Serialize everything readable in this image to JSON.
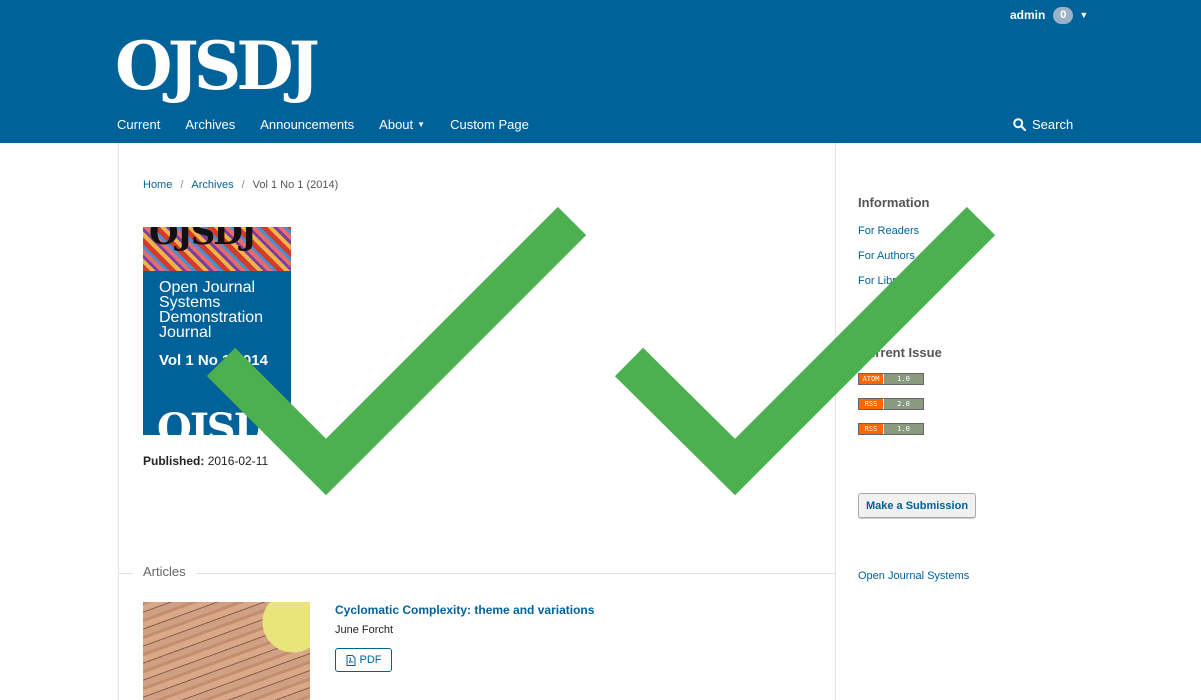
{
  "header": {
    "logo_text": "OJSDJ",
    "user": {
      "name": "admin",
      "task_count": "0"
    },
    "nav": [
      {
        "label": "Current"
      },
      {
        "label": "Archives"
      },
      {
        "label": "Announcements"
      },
      {
        "label": "About"
      },
      {
        "label": "Custom Page"
      }
    ],
    "search_label": "Search"
  },
  "breadcrumb": {
    "home": "Home",
    "archives": "Archives",
    "current": "Vol 1 No 1 (2014)",
    "separator": "/"
  },
  "issue": {
    "cover": {
      "top_logo": "OJSDJ",
      "title": "Open Journal Systems Demonstration Journal",
      "volume": "Vol 1 No 1 2014",
      "bottom_logo": "OJSDJ"
    },
    "published_label": "Published:",
    "published_date": "2016-02-11"
  },
  "articles": {
    "heading": "Articles",
    "items": [
      {
        "title": "Cyclomatic Complexity: theme and variations",
        "author": "June Forcht",
        "galley_label": "PDF"
      }
    ]
  },
  "sidebar": {
    "information_heading": "Information",
    "information_links": [
      "For Readers",
      "For Authors",
      "For Librarians"
    ],
    "current_issue_heading": "Current Issue",
    "feeds": [
      {
        "type": "ATOM",
        "version": "1.0"
      },
      {
        "type": "RSS",
        "version": "2.0"
      },
      {
        "type": "RSS",
        "version": "1.0"
      }
    ],
    "submission_button": "Make a Submission",
    "ojs_link": "Open Journal Systems"
  },
  "colors": {
    "brand": "#006299",
    "checkmark": "#4caf50",
    "feed_orange": "#ff6600"
  },
  "icons": [
    "search-icon",
    "pdf-icon",
    "chevron-down-icon",
    "checkmark-icon"
  ]
}
